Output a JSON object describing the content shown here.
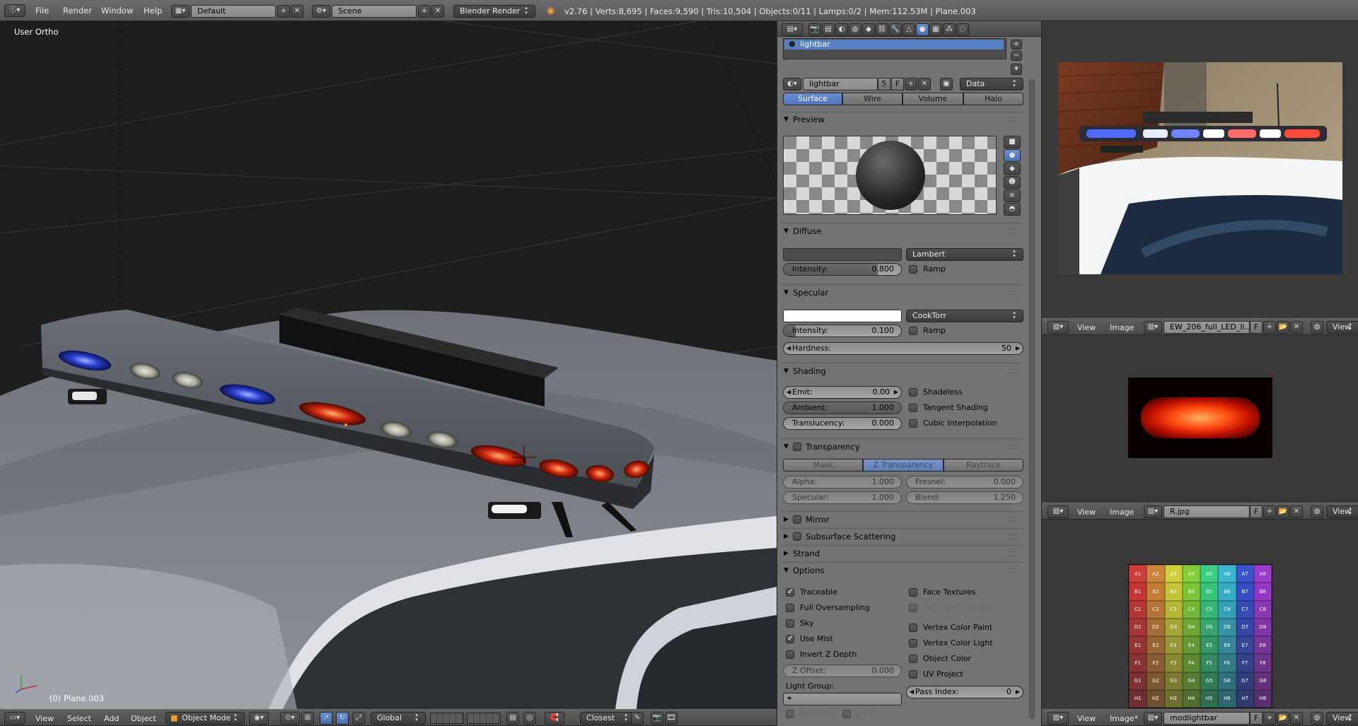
{
  "topbar": {
    "menus": [
      "File",
      "Render",
      "Window",
      "Help"
    ],
    "layout_name": "Default",
    "scene_name": "Scene",
    "render_engine": "Blender Render",
    "stats": "v2.76 | Verts:8,695 | Faces:9,590 | Tris:10,504 | Objects:0/11 | Lamps:0/2 | Mem:112.53M | Plane.003"
  },
  "viewport": {
    "view_label": "User Ortho",
    "object_label": "(0) Plane.003",
    "menus": [
      "View",
      "Select",
      "Add",
      "Object"
    ],
    "mode": "Object Mode",
    "orientation": "Global",
    "snap_target": "Closest"
  },
  "properties": {
    "material_slot": "lightbar",
    "material_name": "lightbar",
    "users": "5",
    "fake_user": "F",
    "link": "Data",
    "tabs": [
      "Surface",
      "Wire",
      "Volume",
      "Halo"
    ],
    "active_tab": "Surface",
    "preview_title": "Preview",
    "diffuse": {
      "title": "Diffuse",
      "shader": "Lambert",
      "intensity_label": "Intensity:",
      "intensity": "0.800",
      "intensity_value": 0.8,
      "ramp": "Ramp",
      "color": "#4d4d4d"
    },
    "specular": {
      "title": "Specular",
      "shader": "CookTorr",
      "intensity_label": "Intensity:",
      "intensity": "0.100",
      "intensity_value": 0.1,
      "ramp": "Ramp",
      "hardness_label": "Hardness:",
      "hardness": "50",
      "color": "#ffffff"
    },
    "shading": {
      "title": "Shading",
      "emit_label": "Emit:",
      "emit": "0.00",
      "ambient_label": "Ambient:",
      "ambient": "1.000",
      "translucency_label": "Translucency:",
      "translucency": "0.000",
      "shadeless": "Shadeless",
      "tangent": "Tangent Shading",
      "cubic": "Cubic Interpolation"
    },
    "transparency": {
      "title": "Transparency",
      "modes": [
        "Mask",
        "Z Transparency",
        "Raytrace"
      ],
      "active_mode": "Z Transparency",
      "alpha_label": "Alpha:",
      "alpha": "1.000",
      "fresnel_label": "Fresnel:",
      "fresnel": "0.000",
      "specular_label": "Specular:",
      "specular": "1.000",
      "blend_label": "Blend:",
      "blend": "1.250"
    },
    "mirror": "Mirror",
    "sss": "Subsurface Scattering",
    "strand": "Strand",
    "options": {
      "title": "Options",
      "traceable": "Traceable",
      "full_oversampling": "Full Oversampling",
      "sky": "Sky",
      "use_mist": "Use Mist",
      "invert_z": "Invert Z Depth",
      "z_offset_label": "Z Offset:",
      "z_offset": "0.000",
      "light_group": "Light Group:",
      "exclusive": "Exclusive",
      "local": "Local",
      "face_textures": "Face Textures",
      "face_textures_alpha": "Face Textures Alpha",
      "vertex_color_paint": "Vertex Color Paint",
      "vertex_color_light": "Vertex Color Light",
      "object_color": "Object Color",
      "uv_project": "UV Project",
      "pass_index_label": "Pass Index:",
      "pass_index": "0"
    }
  },
  "image_editors": [
    {
      "menus": [
        "View",
        "Image"
      ],
      "image": "EW_206_full_LED_li...",
      "fake": "F",
      "trailing": "View"
    },
    {
      "menus": [
        "View",
        "Image"
      ],
      "image": "R.jpg",
      "fake": "F",
      "trailing": "View"
    },
    {
      "menus": [
        "View",
        "Image*"
      ],
      "image": "modlightbar",
      "fake": "F",
      "trailing": "View"
    }
  ],
  "uv_grid_labels": [
    "A1",
    "A2",
    "A3",
    "A4",
    "A5",
    "A6",
    "A7",
    "A8",
    "B1",
    "B2",
    "B3",
    "B4",
    "B5",
    "B6",
    "B7",
    "B8",
    "C1",
    "C2",
    "C3",
    "C4",
    "C5",
    "C6",
    "C7",
    "C8",
    "D1",
    "D2",
    "D3",
    "D4",
    "D5",
    "D6",
    "D7",
    "D8",
    "E1",
    "E2",
    "E3",
    "E4",
    "E5",
    "E6",
    "E7",
    "E8",
    "F1",
    "F2",
    "F3",
    "F4",
    "F5",
    "F6",
    "F7",
    "F8",
    "G1",
    "G2",
    "G3",
    "G4",
    "G5",
    "G6",
    "G7",
    "G8",
    "H1",
    "H2",
    "H3",
    "H4",
    "H5",
    "H6",
    "H7",
    "H8"
  ],
  "colors": {
    "accent": "#5680c2",
    "header": "#727272"
  }
}
